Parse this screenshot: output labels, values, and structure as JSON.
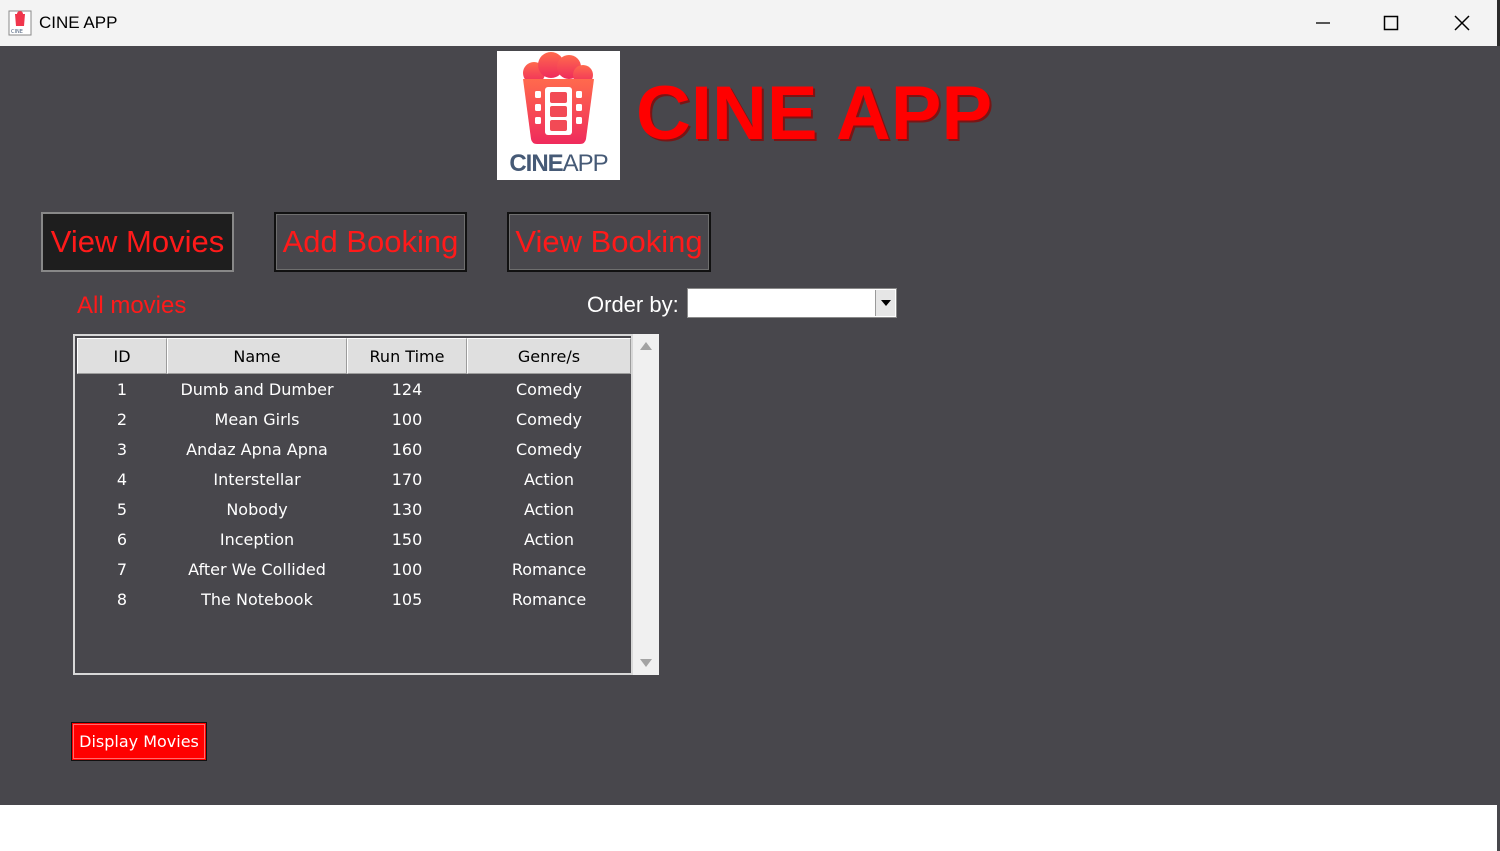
{
  "window": {
    "title": "CINE APP",
    "controls": [
      "minimize-icon",
      "maximize-icon",
      "close-icon"
    ]
  },
  "header": {
    "logo_text_bold": "CINE",
    "logo_text_light": "APP",
    "heading": "CINE APP",
    "accent_color": "#ff0000"
  },
  "nav": {
    "items": [
      {
        "label": "View Movies",
        "active": true
      },
      {
        "label": "Add Booking",
        "active": false
      },
      {
        "label": "View Booking",
        "active": false
      }
    ]
  },
  "main": {
    "section_title": "All movies",
    "order_by_label": "Order by:",
    "order_by_value": "",
    "table": {
      "columns": [
        "ID",
        "Name",
        "Run Time",
        "Genre/s"
      ],
      "rows": [
        [
          "1",
          "Dumb and Dumber",
          "124",
          "Comedy"
        ],
        [
          "2",
          "Mean Girls",
          "100",
          "Comedy"
        ],
        [
          "3",
          "Andaz Apna Apna",
          "160",
          "Comedy"
        ],
        [
          "4",
          "Interstellar",
          "170",
          "Action"
        ],
        [
          "5",
          "Nobody",
          "130",
          "Action"
        ],
        [
          "6",
          "Inception",
          "150",
          "Action"
        ],
        [
          "7",
          "After We Collided",
          "100",
          "Romance"
        ],
        [
          "8",
          "The Notebook",
          "105",
          "Romance"
        ]
      ]
    },
    "display_button_label": "Display Movies"
  }
}
